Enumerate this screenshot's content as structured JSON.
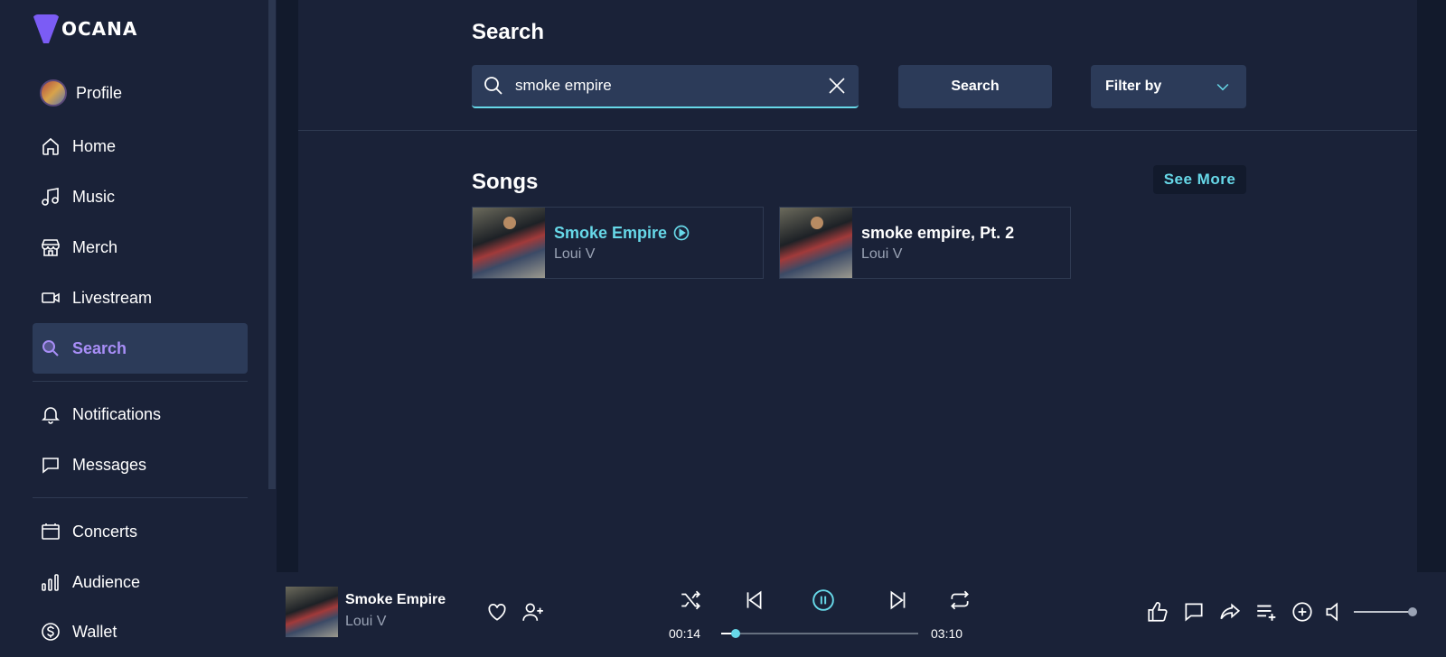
{
  "brand": {
    "logo_text": "OCANA"
  },
  "sidebar": {
    "items": [
      {
        "label": "Profile"
      },
      {
        "label": "Home"
      },
      {
        "label": "Music"
      },
      {
        "label": "Merch"
      },
      {
        "label": "Livestream"
      },
      {
        "label": "Search"
      },
      {
        "label": "Notifications"
      },
      {
        "label": "Messages"
      },
      {
        "label": "Concerts"
      },
      {
        "label": "Audience"
      },
      {
        "label": "Wallet"
      }
    ],
    "active": "Search"
  },
  "search": {
    "title": "Search",
    "query": "smoke empire",
    "button_label": "Search",
    "filter_label": "Filter by"
  },
  "songs": {
    "title": "Songs",
    "see_more_label": "See More",
    "items": [
      {
        "title": "Smoke Empire",
        "artist": "Loui V",
        "playing": true
      },
      {
        "title": "smoke empire, Pt. 2",
        "artist": "Loui V",
        "playing": false
      }
    ]
  },
  "player": {
    "title": "Smoke Empire",
    "artist": "Loui V",
    "current_time": "00:14",
    "duration": "03:10",
    "progress_fraction": 0.074,
    "volume_fraction": 1.0
  },
  "colors": {
    "accent": "#67d8e8",
    "brand": "#7b5cf5",
    "active_nav": "#a88ef7",
    "background": "#1a2238"
  }
}
